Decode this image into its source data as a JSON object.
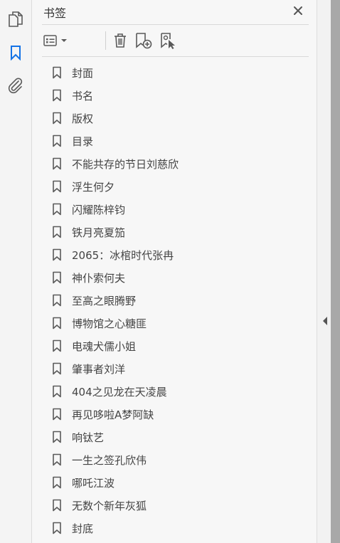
{
  "panel": {
    "title": "书签"
  },
  "rail": {
    "icons": [
      "pages-icon",
      "bookmark-icon",
      "attachment-icon"
    ]
  },
  "toolbar": {
    "icons": [
      "options-menu-icon",
      "delete-icon",
      "new-bookmark-icon",
      "bookmark-from-selection-icon"
    ]
  },
  "colors": {
    "accent": "#1473e6",
    "icon": "#5a5a5a",
    "gutter": "#a8a8a8"
  },
  "bookmarks": [
    "封面",
    "书名",
    "版权",
    "目录",
    "不能共存的节日刘慈欣",
    "浮生何夕",
    "闪耀陈梓钧",
    "铁月亮夏笳",
    "2065：冰棺时代张冉",
    "神仆索何夫",
    "至高之眼腾野",
    "博物馆之心糖匪",
    "电魂犬儒小姐",
    "肇事者刘洋",
    "404之见龙在天凌晨",
    "再见哆啦A梦阿缺",
    "响钛艺",
    "一生之签孔欣伟",
    "哪吒江波",
    "无数个新年灰狐",
    "封底"
  ]
}
